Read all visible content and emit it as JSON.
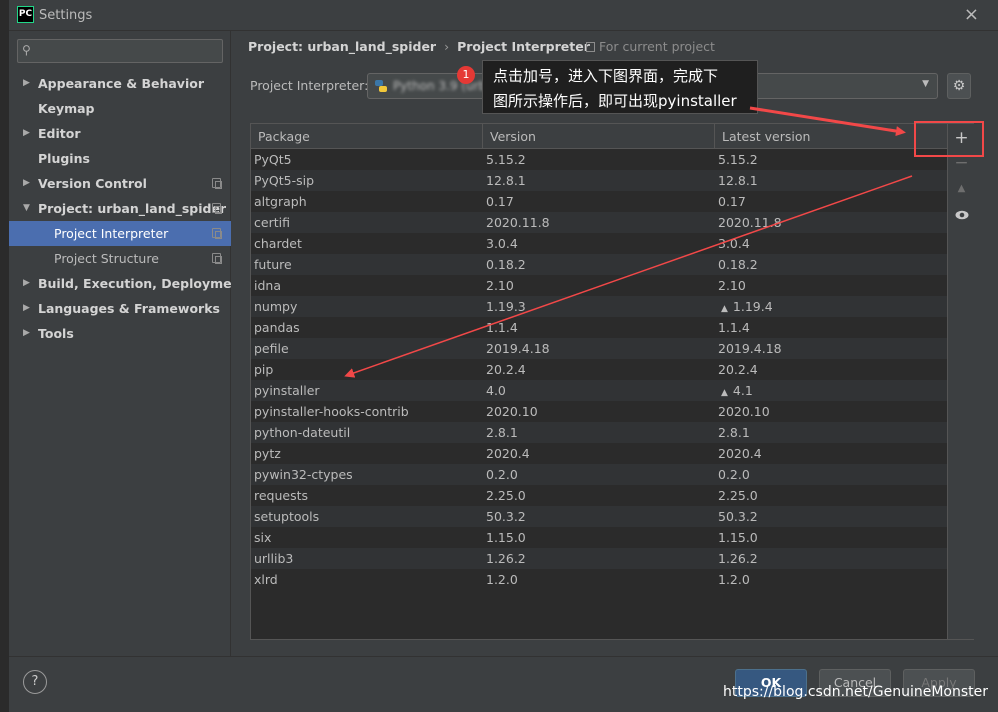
{
  "window": {
    "title": "Settings",
    "app_icon": "PC",
    "close": "×"
  },
  "search": {
    "placeholder": ""
  },
  "sidebar": {
    "items": [
      {
        "label": "Appearance & Behavior",
        "arrow": "▶",
        "icon": ""
      },
      {
        "label": "Keymap",
        "arrow": "",
        "icon": ""
      },
      {
        "label": "Editor",
        "arrow": "▶",
        "icon": ""
      },
      {
        "label": "Plugins",
        "arrow": "",
        "icon": ""
      },
      {
        "label": "Version Control",
        "arrow": "▶",
        "icon": "copy"
      },
      {
        "label": "Project: urban_land_spider",
        "arrow": "▼",
        "icon": "copy"
      },
      {
        "label": "Project Interpreter",
        "arrow": "",
        "icon": "copy"
      },
      {
        "label": "Project Structure",
        "arrow": "",
        "icon": "copy"
      },
      {
        "label": "Build, Execution, Deployment",
        "arrow": "▶",
        "icon": ""
      },
      {
        "label": "Languages & Frameworks",
        "arrow": "▶",
        "icon": ""
      },
      {
        "label": "Tools",
        "arrow": "▶",
        "icon": ""
      }
    ]
  },
  "breadcrumb": {
    "project": "Project: urban_land_spider",
    "sep": "›",
    "page": "Project Interpreter"
  },
  "for_current_project": "For current project",
  "interpreter": {
    "label": "Project Interpreter:",
    "value": "Python 3.9 (urb"
  },
  "table": {
    "headers": [
      "Package",
      "Version",
      "Latest version"
    ],
    "rows": [
      [
        "PyQt5",
        "5.15.2",
        "5.15.2",
        false
      ],
      [
        "PyQt5-sip",
        "12.8.1",
        "12.8.1",
        false
      ],
      [
        "altgraph",
        "0.17",
        "0.17",
        false
      ],
      [
        "certifi",
        "2020.11.8",
        "2020.11.8",
        false
      ],
      [
        "chardet",
        "3.0.4",
        "3.0.4",
        false
      ],
      [
        "future",
        "0.18.2",
        "0.18.2",
        false
      ],
      [
        "idna",
        "2.10",
        "2.10",
        false
      ],
      [
        "numpy",
        "1.19.3",
        "1.19.4",
        true
      ],
      [
        "pandas",
        "1.1.4",
        "1.1.4",
        false
      ],
      [
        "pefile",
        "2019.4.18",
        "2019.4.18",
        false
      ],
      [
        "pip",
        "20.2.4",
        "20.2.4",
        false
      ],
      [
        "pyinstaller",
        "4.0",
        "4.1",
        true
      ],
      [
        "pyinstaller-hooks-contrib",
        "2020.10",
        "2020.10",
        false
      ],
      [
        "python-dateutil",
        "2.8.1",
        "2.8.1",
        false
      ],
      [
        "pytz",
        "2020.4",
        "2020.4",
        false
      ],
      [
        "pywin32-ctypes",
        "0.2.0",
        "0.2.0",
        false
      ],
      [
        "requests",
        "2.25.0",
        "2.25.0",
        false
      ],
      [
        "setuptools",
        "50.3.2",
        "50.3.2",
        false
      ],
      [
        "six",
        "1.15.0",
        "1.15.0",
        false
      ],
      [
        "urllib3",
        "1.26.2",
        "1.26.2",
        false
      ],
      [
        "xlrd",
        "1.2.0",
        "1.2.0",
        false
      ]
    ]
  },
  "tools": {
    "add": "+",
    "remove": "−",
    "up": "▲",
    "show": "eye"
  },
  "footer": {
    "help": "?",
    "ok": "OK",
    "cancel": "Cancel",
    "apply": "Apply"
  },
  "annotation": {
    "badge": "1",
    "line1": "点击加号，进入下图界面，完成下",
    "line2": "图所示操作后，即可出现pyinstaller",
    "color": "#f24848"
  },
  "watermark": "https://blog.csdn.net/GenuineMonster"
}
